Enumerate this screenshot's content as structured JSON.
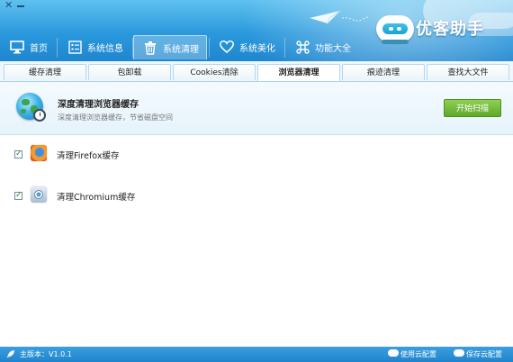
{
  "window": {
    "brand": "优客助手"
  },
  "nav": [
    {
      "label": "首页",
      "icon": "monitor-icon"
    },
    {
      "label": "系统信息",
      "icon": "info-list-icon"
    },
    {
      "label": "系统清理",
      "icon": "trash-icon",
      "active": true
    },
    {
      "label": "系统美化",
      "icon": "heart-icon"
    },
    {
      "label": "功能大全",
      "icon": "command-icon"
    }
  ],
  "subtabs": [
    {
      "label": "缓存清理"
    },
    {
      "label": "包卸载"
    },
    {
      "label": "Cookies清除"
    },
    {
      "label": "浏览器清理",
      "active": true
    },
    {
      "label": "痕迹清理"
    },
    {
      "label": "查找大文件"
    }
  ],
  "feature": {
    "title": "深度清理浏览器缓存",
    "description": "深度清理浏览器缓存，节省磁盘空间",
    "scan_button": "开始扫描"
  },
  "items": [
    {
      "label": "清理Firefox缓存",
      "checked": true,
      "icon": "firefox-icon"
    },
    {
      "label": "清理Chromium缓存",
      "checked": true,
      "icon": "chromium-icon"
    }
  ],
  "status": {
    "version": "主版本：V1.0.1",
    "use_config": "使用云配置",
    "save_config": "保存云配置"
  },
  "colors": {
    "header": "#2a98dc",
    "accent_green": "#5ea829",
    "status_bar": "#1f84cd"
  }
}
